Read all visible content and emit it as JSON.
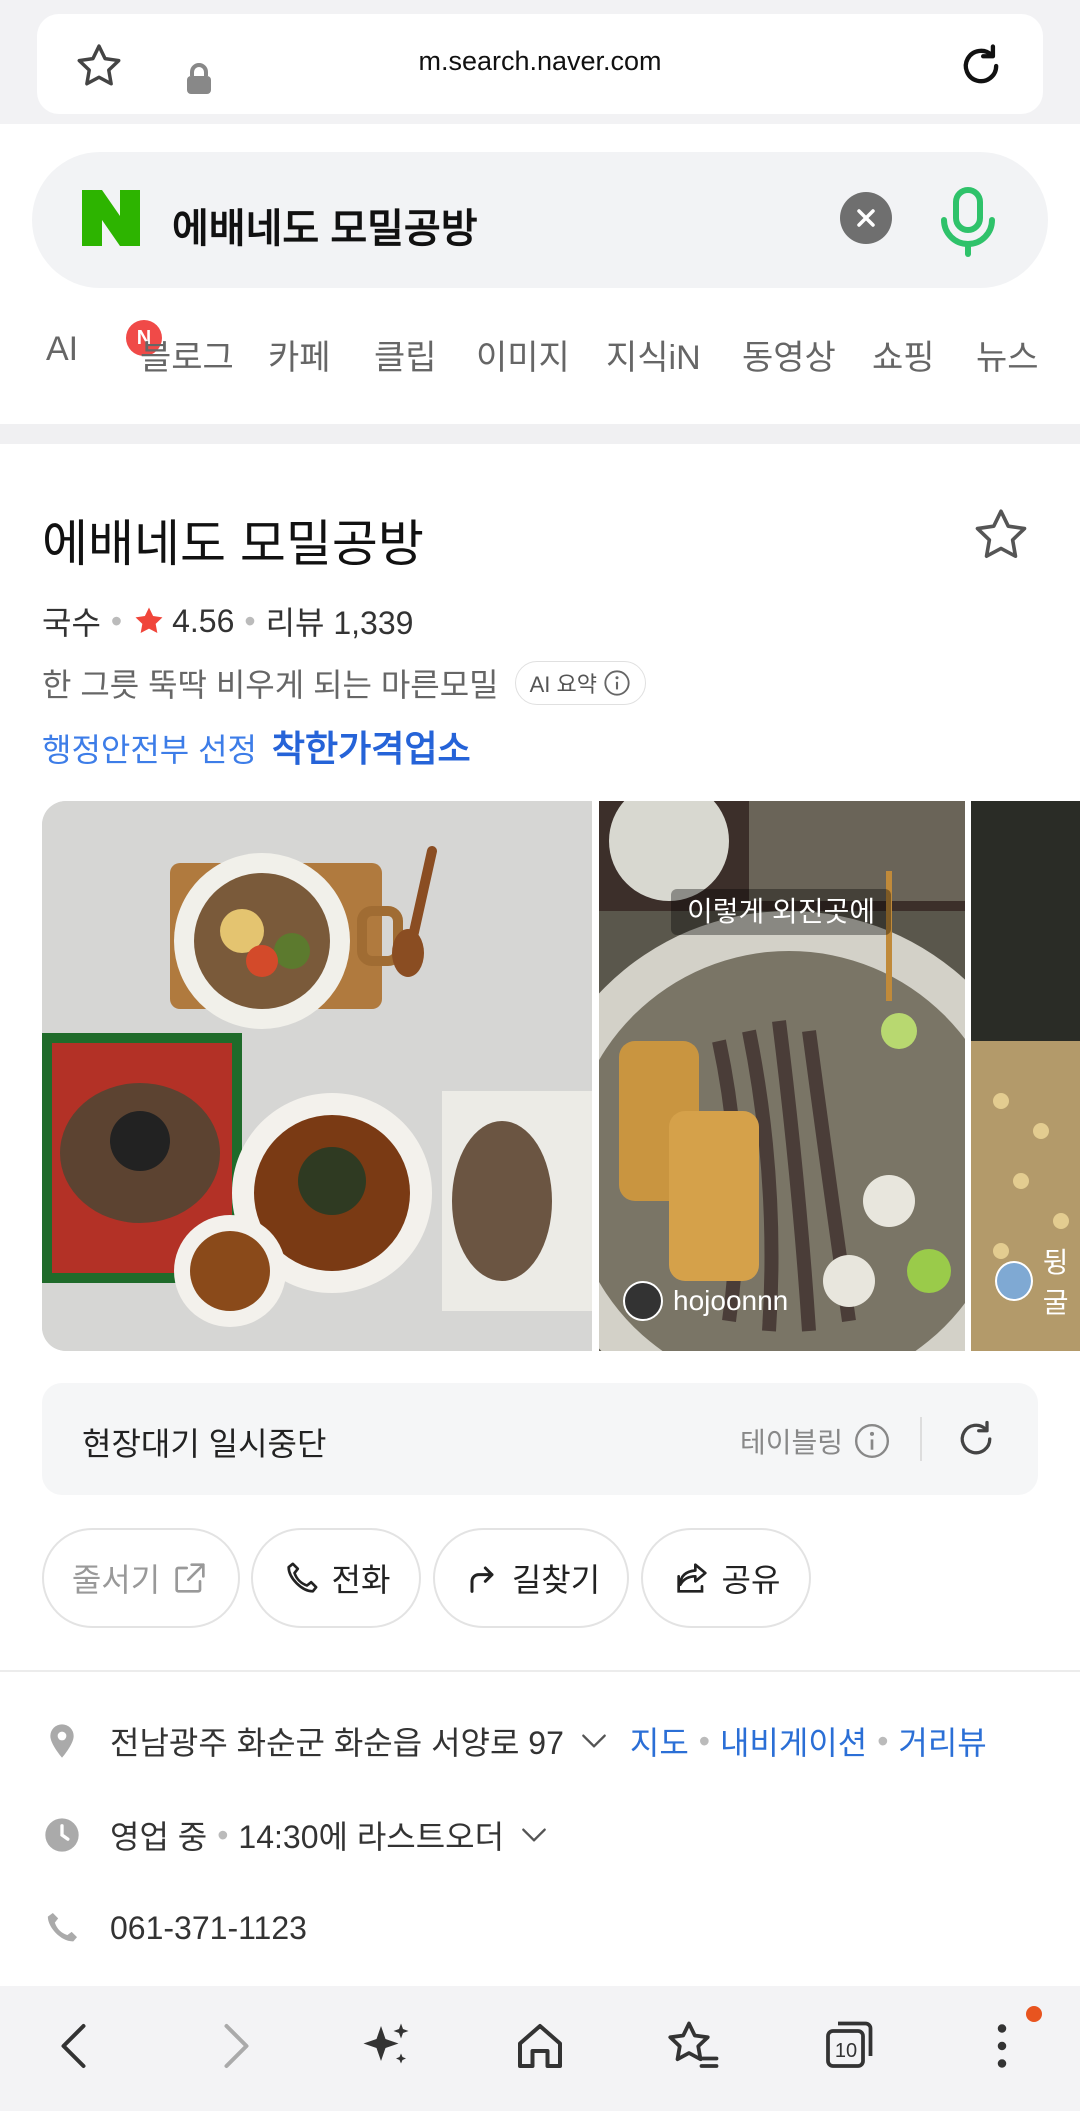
{
  "browser": {
    "url": "m.search.naver.com"
  },
  "search": {
    "query": "에배네도 모밀공방"
  },
  "tabs": [
    {
      "label": "AI",
      "badge": "N"
    },
    {
      "label": "블로그"
    },
    {
      "label": "카페"
    },
    {
      "label": "클립"
    },
    {
      "label": "이미지"
    },
    {
      "label": "지식iN"
    },
    {
      "label": "동영상"
    },
    {
      "label": "쇼핑"
    },
    {
      "label": "뉴스"
    }
  ],
  "place": {
    "name": "에배네도 모밀공방",
    "category": "국수",
    "rating": "4.56",
    "reviews": "리뷰 1,339",
    "summary": "한 그릇 뚝딱 비우게 되는 마른모밀",
    "ai_summary_label": "AI 요약",
    "gov_label": "행정안전부 선정",
    "good_price_label": "착한가격업소"
  },
  "photos": {
    "caption": "이렇게 외진곳에",
    "user1": "hojoonnn",
    "user3": "뒹굴"
  },
  "waiting": {
    "status": "현장대기 일시중단",
    "provider": "테이블링"
  },
  "actions": {
    "queue": "줄서기",
    "call": "전화",
    "directions": "길찾기",
    "share": "공유"
  },
  "info": {
    "address": "전남광주 화순군 화순읍 서양로 97",
    "map": "지도",
    "navigation": "내비게이션",
    "street_view": "거리뷰",
    "hours_status": "영업 중",
    "last_order": "14:30에 라스트오더",
    "phone": "061-371-1123"
  },
  "bottom_nav": {
    "tab_count": "10"
  },
  "colors": {
    "naver_green": "#2db400",
    "link_blue": "#2b6fd6",
    "rating_red": "#f0453a",
    "badge_red": "#f04a48"
  }
}
